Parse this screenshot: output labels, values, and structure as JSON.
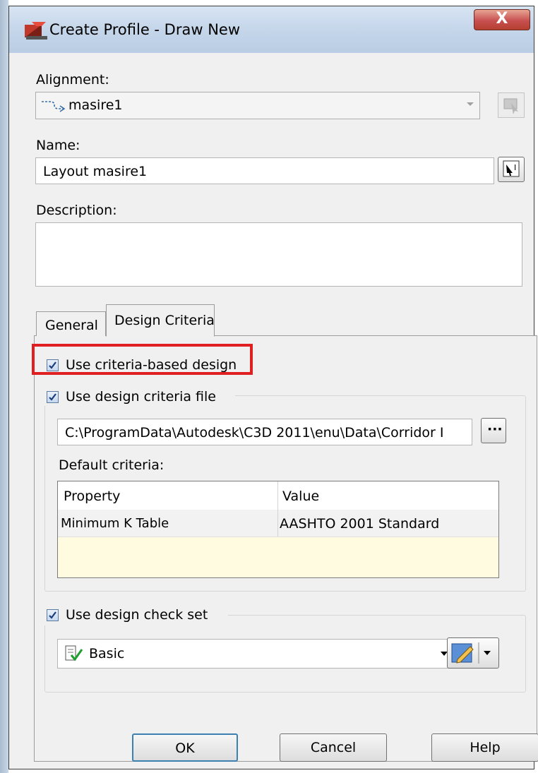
{
  "window": {
    "title": "Create Profile - Draw New",
    "close_glyph": "X"
  },
  "alignment": {
    "label": "Alignment:",
    "value": "masire1",
    "icon": "alignment-icon"
  },
  "name": {
    "label": "Name:",
    "value": "Layout masire1"
  },
  "description": {
    "label": "Description:",
    "value": ""
  },
  "tabs": [
    {
      "label": "General",
      "active": false
    },
    {
      "label": "Design Criteria",
      "active": true
    }
  ],
  "design_criteria": {
    "use_criteria_based_design": {
      "label": "Use criteria-based design",
      "checked": true
    },
    "use_design_criteria_file": {
      "label": "Use design criteria file",
      "checked": true
    },
    "criteria_file_path": "C:\\ProgramData\\Autodesk\\C3D 2011\\enu\\Data\\Corridor I",
    "browse_glyph": "···",
    "default_criteria_label": "Default criteria:",
    "table": {
      "headers": [
        "Property",
        "Value"
      ],
      "rows": [
        [
          "Minimum K Table",
          "AASHTO 2001 Standard"
        ]
      ]
    },
    "use_design_check_set": {
      "label": "Use design check set",
      "checked": true
    },
    "check_set": {
      "value": "Basic",
      "icon": "check-set-icon"
    }
  },
  "buttons": {
    "ok": "OK",
    "cancel": "Cancel",
    "help": "Help"
  },
  "colors": {
    "highlight": "#e02020",
    "title_bar": "#c5d6ea",
    "default_button_border": "#3c7fb1"
  }
}
